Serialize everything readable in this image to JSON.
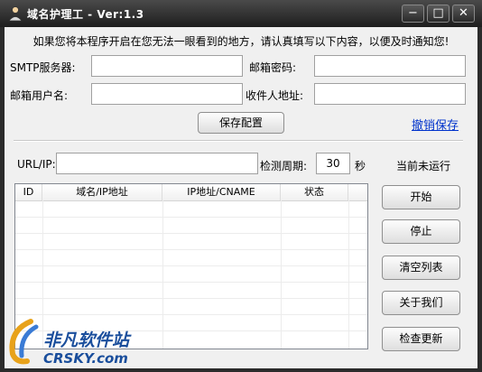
{
  "window": {
    "title": "域名护理工 - Ver:1.3",
    "controls": {
      "minimize": "−",
      "maximize": "□",
      "close": "✕"
    }
  },
  "notice": "如果您将本程序开启在您无法一眼看到的地方，请认真填写以下内容，以便及时通知您!",
  "smtp": {
    "label": "SMTP服务器:",
    "value": ""
  },
  "mail_password": {
    "label": "邮箱密码:",
    "value": ""
  },
  "mail_user": {
    "label": "邮箱用户名:",
    "value": ""
  },
  "recipient": {
    "label": "收件人地址:",
    "value": ""
  },
  "save_config": "保存配置",
  "undo_save": "撤销保存",
  "url_ip": {
    "label": "URL/IP:",
    "value": ""
  },
  "interval": {
    "label": "检测周期:",
    "value": "30",
    "unit": "秒"
  },
  "status": "当前未运行",
  "table": {
    "columns": [
      "ID",
      "域名/IP地址",
      "IP地址/CNAME",
      "状态"
    ],
    "rows": []
  },
  "actions": {
    "start": "开始",
    "stop": "停止",
    "clear": "清空列表",
    "about": "关于我们",
    "update": "检查更新"
  },
  "watermark": {
    "name": "非凡软件站",
    "site": "CRSKY.com"
  },
  "colors": {
    "titlebar": "#2b2b2b",
    "link": "#0033cc",
    "client": "#f0f0f0"
  }
}
